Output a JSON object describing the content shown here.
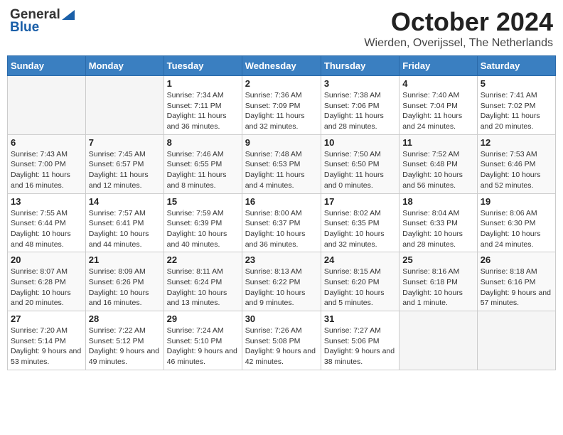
{
  "header": {
    "logo_general": "General",
    "logo_blue": "Blue",
    "title": "October 2024",
    "subtitle": "Wierden, Overijssel, The Netherlands"
  },
  "weekdays": [
    "Sunday",
    "Monday",
    "Tuesday",
    "Wednesday",
    "Thursday",
    "Friday",
    "Saturday"
  ],
  "weeks": [
    [
      {
        "day": "",
        "empty": true
      },
      {
        "day": "",
        "empty": true
      },
      {
        "day": "1",
        "sunrise": "Sunrise: 7:34 AM",
        "sunset": "Sunset: 7:11 PM",
        "daylight": "Daylight: 11 hours and 36 minutes."
      },
      {
        "day": "2",
        "sunrise": "Sunrise: 7:36 AM",
        "sunset": "Sunset: 7:09 PM",
        "daylight": "Daylight: 11 hours and 32 minutes."
      },
      {
        "day": "3",
        "sunrise": "Sunrise: 7:38 AM",
        "sunset": "Sunset: 7:06 PM",
        "daylight": "Daylight: 11 hours and 28 minutes."
      },
      {
        "day": "4",
        "sunrise": "Sunrise: 7:40 AM",
        "sunset": "Sunset: 7:04 PM",
        "daylight": "Daylight: 11 hours and 24 minutes."
      },
      {
        "day": "5",
        "sunrise": "Sunrise: 7:41 AM",
        "sunset": "Sunset: 7:02 PM",
        "daylight": "Daylight: 11 hours and 20 minutes."
      }
    ],
    [
      {
        "day": "6",
        "sunrise": "Sunrise: 7:43 AM",
        "sunset": "Sunset: 7:00 PM",
        "daylight": "Daylight: 11 hours and 16 minutes."
      },
      {
        "day": "7",
        "sunrise": "Sunrise: 7:45 AM",
        "sunset": "Sunset: 6:57 PM",
        "daylight": "Daylight: 11 hours and 12 minutes."
      },
      {
        "day": "8",
        "sunrise": "Sunrise: 7:46 AM",
        "sunset": "Sunset: 6:55 PM",
        "daylight": "Daylight: 11 hours and 8 minutes."
      },
      {
        "day": "9",
        "sunrise": "Sunrise: 7:48 AM",
        "sunset": "Sunset: 6:53 PM",
        "daylight": "Daylight: 11 hours and 4 minutes."
      },
      {
        "day": "10",
        "sunrise": "Sunrise: 7:50 AM",
        "sunset": "Sunset: 6:50 PM",
        "daylight": "Daylight: 11 hours and 0 minutes."
      },
      {
        "day": "11",
        "sunrise": "Sunrise: 7:52 AM",
        "sunset": "Sunset: 6:48 PM",
        "daylight": "Daylight: 10 hours and 56 minutes."
      },
      {
        "day": "12",
        "sunrise": "Sunrise: 7:53 AM",
        "sunset": "Sunset: 6:46 PM",
        "daylight": "Daylight: 10 hours and 52 minutes."
      }
    ],
    [
      {
        "day": "13",
        "sunrise": "Sunrise: 7:55 AM",
        "sunset": "Sunset: 6:44 PM",
        "daylight": "Daylight: 10 hours and 48 minutes."
      },
      {
        "day": "14",
        "sunrise": "Sunrise: 7:57 AM",
        "sunset": "Sunset: 6:41 PM",
        "daylight": "Daylight: 10 hours and 44 minutes."
      },
      {
        "day": "15",
        "sunrise": "Sunrise: 7:59 AM",
        "sunset": "Sunset: 6:39 PM",
        "daylight": "Daylight: 10 hours and 40 minutes."
      },
      {
        "day": "16",
        "sunrise": "Sunrise: 8:00 AM",
        "sunset": "Sunset: 6:37 PM",
        "daylight": "Daylight: 10 hours and 36 minutes."
      },
      {
        "day": "17",
        "sunrise": "Sunrise: 8:02 AM",
        "sunset": "Sunset: 6:35 PM",
        "daylight": "Daylight: 10 hours and 32 minutes."
      },
      {
        "day": "18",
        "sunrise": "Sunrise: 8:04 AM",
        "sunset": "Sunset: 6:33 PM",
        "daylight": "Daylight: 10 hours and 28 minutes."
      },
      {
        "day": "19",
        "sunrise": "Sunrise: 8:06 AM",
        "sunset": "Sunset: 6:30 PM",
        "daylight": "Daylight: 10 hours and 24 minutes."
      }
    ],
    [
      {
        "day": "20",
        "sunrise": "Sunrise: 8:07 AM",
        "sunset": "Sunset: 6:28 PM",
        "daylight": "Daylight: 10 hours and 20 minutes."
      },
      {
        "day": "21",
        "sunrise": "Sunrise: 8:09 AM",
        "sunset": "Sunset: 6:26 PM",
        "daylight": "Daylight: 10 hours and 16 minutes."
      },
      {
        "day": "22",
        "sunrise": "Sunrise: 8:11 AM",
        "sunset": "Sunset: 6:24 PM",
        "daylight": "Daylight: 10 hours and 13 minutes."
      },
      {
        "day": "23",
        "sunrise": "Sunrise: 8:13 AM",
        "sunset": "Sunset: 6:22 PM",
        "daylight": "Daylight: 10 hours and 9 minutes."
      },
      {
        "day": "24",
        "sunrise": "Sunrise: 8:15 AM",
        "sunset": "Sunset: 6:20 PM",
        "daylight": "Daylight: 10 hours and 5 minutes."
      },
      {
        "day": "25",
        "sunrise": "Sunrise: 8:16 AM",
        "sunset": "Sunset: 6:18 PM",
        "daylight": "Daylight: 10 hours and 1 minute."
      },
      {
        "day": "26",
        "sunrise": "Sunrise: 8:18 AM",
        "sunset": "Sunset: 6:16 PM",
        "daylight": "Daylight: 9 hours and 57 minutes."
      }
    ],
    [
      {
        "day": "27",
        "sunrise": "Sunrise: 7:20 AM",
        "sunset": "Sunset: 5:14 PM",
        "daylight": "Daylight: 9 hours and 53 minutes."
      },
      {
        "day": "28",
        "sunrise": "Sunrise: 7:22 AM",
        "sunset": "Sunset: 5:12 PM",
        "daylight": "Daylight: 9 hours and 49 minutes."
      },
      {
        "day": "29",
        "sunrise": "Sunrise: 7:24 AM",
        "sunset": "Sunset: 5:10 PM",
        "daylight": "Daylight: 9 hours and 46 minutes."
      },
      {
        "day": "30",
        "sunrise": "Sunrise: 7:26 AM",
        "sunset": "Sunset: 5:08 PM",
        "daylight": "Daylight: 9 hours and 42 minutes."
      },
      {
        "day": "31",
        "sunrise": "Sunrise: 7:27 AM",
        "sunset": "Sunset: 5:06 PM",
        "daylight": "Daylight: 9 hours and 38 minutes."
      },
      {
        "day": "",
        "empty": true
      },
      {
        "day": "",
        "empty": true
      }
    ]
  ]
}
